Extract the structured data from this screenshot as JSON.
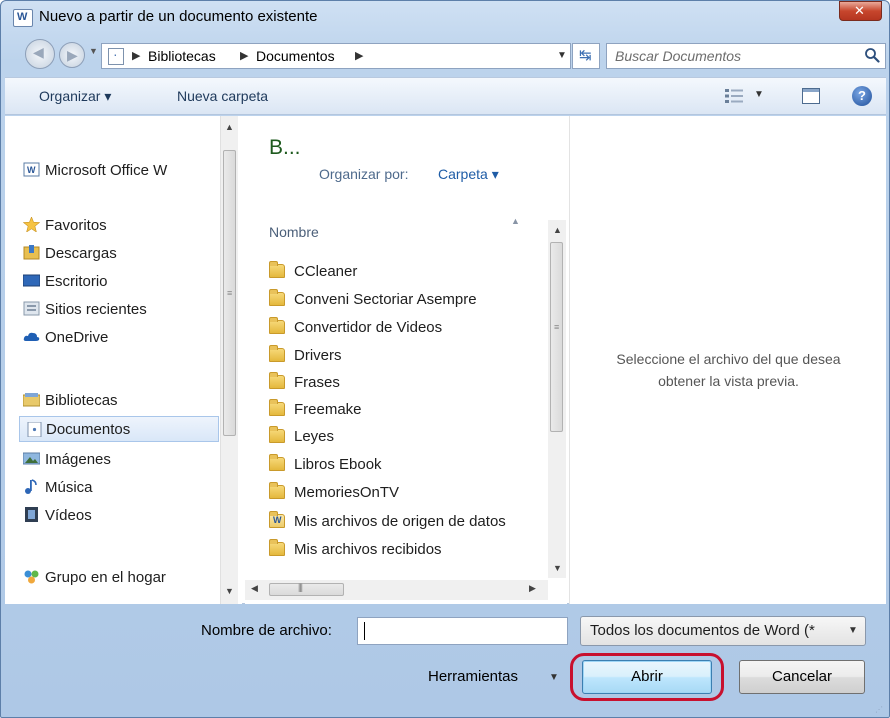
{
  "window": {
    "title": "Nuevo a partir de un documento existente"
  },
  "address": {
    "segments": [
      "Bibliotecas",
      "Documentos"
    ],
    "search_placeholder": "Buscar Documentos"
  },
  "toolbar": {
    "organize_label": "Organizar ▾",
    "new_folder_label": "Nueva carpeta"
  },
  "navigation": {
    "items": [
      {
        "label": "Microsoft Office W",
        "icon": "word-icon"
      },
      {
        "label": "Favoritos",
        "icon": "star-icon"
      },
      {
        "label": "Descargas",
        "icon": "downloads-icon"
      },
      {
        "label": "Escritorio",
        "icon": "desktop-icon"
      },
      {
        "label": "Sitios recientes",
        "icon": "recent-places-icon"
      },
      {
        "label": "OneDrive",
        "icon": "onedrive-icon"
      },
      {
        "label": "Bibliotecas",
        "icon": "libraries-icon"
      },
      {
        "label": "Documentos",
        "icon": "documents-icon",
        "selected": true
      },
      {
        "label": "Imágenes",
        "icon": "pictures-icon"
      },
      {
        "label": "Música",
        "icon": "music-icon"
      },
      {
        "label": "Vídeos",
        "icon": "videos-icon"
      },
      {
        "label": "Grupo en el hogar",
        "icon": "homegroup-icon"
      }
    ]
  },
  "filelist": {
    "library_title": "B...",
    "arrange_label": "Organizar por:",
    "arrange_value": "Carpeta ▾",
    "column_name": "Nombre",
    "items": [
      "CCleaner",
      "Conveni Sectoriar Asempre",
      "Convertidor de Videos",
      "Drivers",
      "Frases",
      "Freemake",
      "Leyes",
      "Libros Ebook",
      "MemoriesOnTV",
      "Mis archivos de origen de datos",
      "Mis archivos recibidos"
    ]
  },
  "preview": {
    "line1": "Seleccione el archivo del que desea",
    "line2": "obtener la vista previa."
  },
  "footer": {
    "filename_label": "Nombre de archivo:",
    "filename_value": "",
    "filter_value": "Todos los documentos de Word (*",
    "tools_label": "Herramientas",
    "open_label": "Abrir",
    "cancel_label": "Cancelar"
  },
  "colors": {
    "highlight": "#c8102e",
    "accent": "#1e5ca6"
  }
}
